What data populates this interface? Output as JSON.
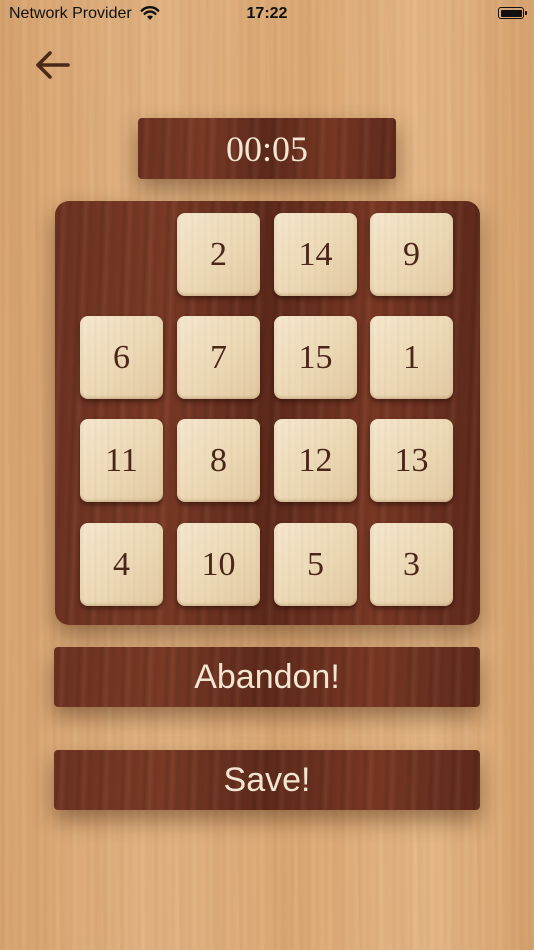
{
  "status_bar": {
    "carrier": "Network Provider",
    "time": "17:22"
  },
  "timer": "00:05",
  "tiles": [
    "",
    "2",
    "14",
    "9",
    "6",
    "7",
    "15",
    "1",
    "11",
    "8",
    "12",
    "13",
    "4",
    "10",
    "5",
    "3"
  ],
  "buttons": {
    "abandon": "Abandon!",
    "save": "Save!"
  },
  "colors": {
    "dark_wood": "#6e3322",
    "tile": "#f1e2c6",
    "tile_text": "#4a2718",
    "light_wood": "#e0b17e"
  }
}
